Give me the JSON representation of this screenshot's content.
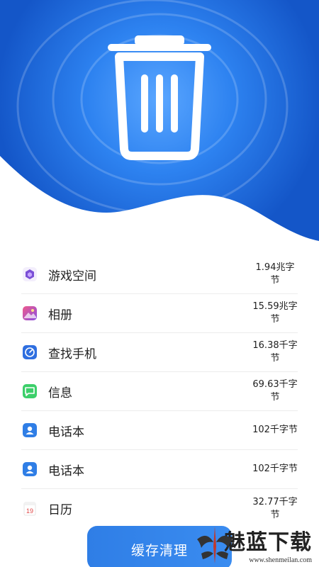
{
  "apps": [
    {
      "name": "游戏空间",
      "size": "1.94兆字节",
      "icon": "game-space-icon",
      "color": "#7b4fd6"
    },
    {
      "name": "相册",
      "size": "15.59兆字节",
      "icon": "gallery-icon",
      "color": "#d64fa3"
    },
    {
      "name": "查找手机",
      "size": "16.38千字节",
      "icon": "find-phone-icon",
      "color": "#2f6fe0"
    },
    {
      "name": "信息",
      "size": "69.63千字节",
      "icon": "messages-icon",
      "color": "#3ccf6a"
    },
    {
      "name": "电话本",
      "size": "102千字节",
      "icon": "contacts-icon",
      "color": "#2f7ee6"
    },
    {
      "name": "电话本",
      "size": "102千字节",
      "icon": "contacts-icon",
      "color": "#2f7ee6"
    },
    {
      "name": "日历",
      "size": "32.77千字节",
      "icon": "calendar-icon",
      "color": "#e04848"
    }
  ],
  "calendar_icon_day": "19",
  "clean_button_label": "缓存清理",
  "watermark": {
    "logo": "魅蓝下载",
    "url": "www.shenmeilan.com"
  },
  "colors": {
    "hero_blue": "#1f73e6",
    "button_blue": "#3087ec"
  }
}
